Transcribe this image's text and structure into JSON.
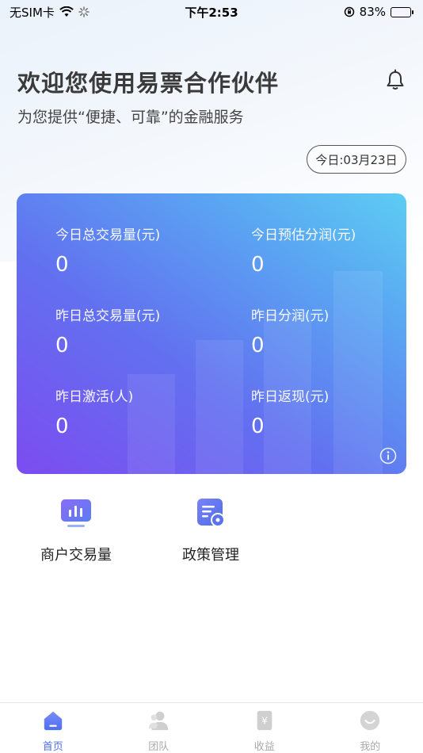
{
  "status_bar": {
    "carrier": "无SIM卡",
    "time": "下午2:53",
    "battery": "83%",
    "battery_level": 0.83
  },
  "header": {
    "title": "欢迎您使用易票合作伙伴",
    "subtitle": "为您提供“便捷、可靠”的金融服务",
    "date": "今日:03月23日"
  },
  "stats": [
    {
      "label": "今日总交易量(元)",
      "value": "0"
    },
    {
      "label": "今日预估分润(元)",
      "value": "0"
    },
    {
      "label": "昨日总交易量(元)",
      "value": "0"
    },
    {
      "label": "昨日分润(元)",
      "value": "0"
    },
    {
      "label": "昨日激活(人)",
      "value": "0"
    },
    {
      "label": "昨日返现(元)",
      "value": "0"
    }
  ],
  "shortcuts": [
    {
      "label": "商户交易量",
      "icon": "bar-chart-monitor-icon"
    },
    {
      "label": "政策管理",
      "icon": "document-settings-icon"
    }
  ],
  "tabs": [
    {
      "label": "首页",
      "icon": "home-icon",
      "active": true
    },
    {
      "label": "团队",
      "icon": "team-icon",
      "active": false
    },
    {
      "label": "收益",
      "icon": "income-icon",
      "active": false
    },
    {
      "label": "我的",
      "icon": "profile-icon",
      "active": false
    }
  ],
  "colors": {
    "accent": "#4f6ef3",
    "card_start": "#7c4cf0",
    "card_end": "#5dcdf3",
    "tab_inactive": "#aaaaaa"
  }
}
